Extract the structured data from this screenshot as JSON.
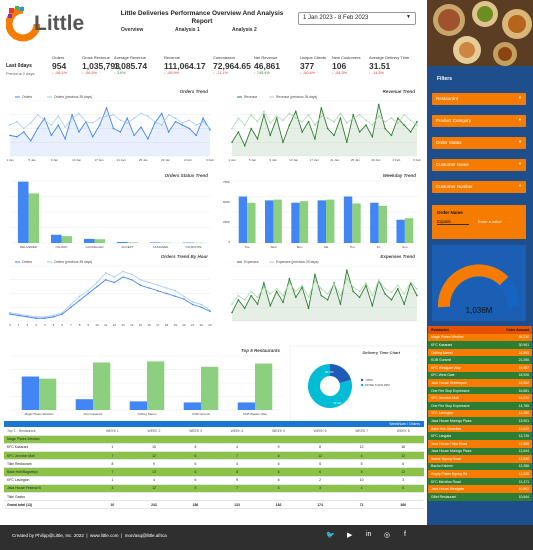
{
  "brand": {
    "name": "Little"
  },
  "title": "Little Deliveries Performance Overview And Analysis Report",
  "nav": [
    "Overview",
    "Analysis 1",
    "Analysis 2"
  ],
  "date_range": "1 Jan 2023 - 8 Feb 2023",
  "last_days": {
    "label": "Last 0days",
    "sub": "Previous 0 days"
  },
  "kpis": [
    {
      "label": "Orders",
      "value": "954",
      "delta": "↓ -56.1%",
      "dir": "down"
    },
    {
      "label": "Gross Revenue",
      "value": "1,035,793",
      "delta": "↓ -56.4%",
      "dir": "down"
    },
    {
      "label": "Average Revenue",
      "value": "1,085.74",
      "delta": "↑ 3.6%",
      "dir": "up"
    },
    {
      "label": "Revenue",
      "value": "111,064.17",
      "delta": "↓ -55.9%",
      "dir": "down"
    },
    {
      "label": "Commission",
      "value": "72,964.65",
      "delta": "↓ -71.1%",
      "dir": "down"
    },
    {
      "label": "Net Revenue",
      "value": "46,861",
      "delta": "↑ 745.4%",
      "dir": "up"
    },
    {
      "label": "Unique Clients",
      "value": "377",
      "delta": "↓ -50.4%",
      "dir": "down"
    },
    {
      "label": "New Customers",
      "value": "106",
      "delta": "↓ -54.3%",
      "dir": "down"
    },
    {
      "label": "Average Delivery Time",
      "value": "31.51",
      "delta": "↓ -14.5%",
      "dir": "down"
    }
  ],
  "charts": {
    "orders_trend": {
      "title": "Orders Trend",
      "legend": [
        "Orders",
        "Orders (previous 39 days)"
      ],
      "colors": [
        "#4285f4",
        "#9fc5f8"
      ],
      "ticks": [
        "1 Jan",
        "5 Jan",
        "9 Jan",
        "13 Jan",
        "17 Jan",
        "21 Jan",
        "25 Jan",
        "29 Jan",
        "2 Feb",
        "6 Feb"
      ]
    },
    "revenue_trend": {
      "title": "Revenue Trend",
      "legend": [
        "Revenue",
        "Revenue (previous 39 days)"
      ],
      "colors": [
        "#2e7d32",
        "#a5d6a7"
      ],
      "ticks": [
        "1 Jan",
        "5 Jan",
        "9 Jan",
        "13 Jan",
        "17 Jan",
        "21 Jan",
        "25 Jan",
        "29 Jan",
        "2 Feb",
        "6 Feb"
      ]
    },
    "status_trend": {
      "title": "Orders Status Trend",
      "categories": [
        "DELIVERED",
        "ON-WAY",
        "CANCELLED",
        "ACCEPT",
        "ASSIGNED",
        "ON-ROUTE"
      ]
    },
    "weekday_trend": {
      "title": "Weekday Trend",
      "categories": [
        "Tue",
        "Wed",
        "Mon",
        "Sat",
        "Thu",
        "Fri",
        "Sun"
      ],
      "yticks": [
        "750K",
        "500K",
        "250K",
        "0"
      ]
    },
    "hour_trend": {
      "title": "Orders Trend By Hour",
      "legend": [
        "Orders",
        "Orders (previous 39 days)"
      ],
      "ticks": [
        "0",
        "1",
        "2",
        "3",
        "4",
        "5",
        "6",
        "7",
        "8",
        "9",
        "10",
        "11",
        "12",
        "13",
        "14",
        "15",
        "16",
        "17",
        "18",
        "19",
        "20",
        "21",
        "22",
        "23"
      ]
    },
    "expenses_trend": {
      "title": "Expenses Trend",
      "legend": [
        "Expenses",
        "Expenses (previous 39 days)"
      ]
    },
    "top5": {
      "title": "Top 5 Restaurants",
      "categories": [
        "Magic Plates Westlan",
        "KFC Kasarani",
        "Golfing Damei",
        "KOB Gursmit",
        "KOB Walden Way"
      ]
    },
    "delivery_time": {
      "title": "Delivery Time Chart",
      "legend": [
        "<25M",
        "MORE THAN 25M"
      ],
      "values": [
        20.4,
        79.6
      ],
      "labels": [
        "20.4%",
        "79.6%"
      ]
    }
  },
  "chart_data": [
    {
      "type": "line",
      "title": "Orders Trend",
      "series": [
        {
          "name": "Orders",
          "values": [
            30,
            28,
            35,
            22,
            40,
            55,
            30,
            45,
            25,
            60,
            35,
            50,
            28,
            45,
            70,
            40,
            35,
            55,
            30,
            42,
            25,
            48,
            62,
            35,
            50,
            45,
            40,
            30,
            55,
            38
          ]
        },
        {
          "name": "Orders (previous 39 days)",
          "values": [
            45,
            50,
            40,
            48,
            60,
            52,
            45,
            58,
            42,
            55,
            62,
            50,
            48,
            55,
            58,
            60,
            52,
            48,
            55,
            62,
            58,
            50,
            45,
            60,
            55,
            48,
            52,
            45,
            50,
            40
          ]
        }
      ]
    },
    {
      "type": "line",
      "title": "Revenue Trend",
      "series": [
        {
          "name": "Revenue",
          "values": [
            20,
            35,
            15,
            40,
            25,
            60,
            30,
            55,
            20,
            45,
            65,
            35,
            50,
            25,
            70,
            40,
            30,
            55,
            20,
            60,
            35,
            45,
            28,
            75,
            40,
            30,
            55,
            45,
            35,
            50
          ]
        },
        {
          "name": "Revenue (previous 39 days)",
          "values": [
            40,
            55,
            45,
            60,
            50,
            65,
            48,
            58,
            52,
            62,
            55,
            50,
            60,
            45,
            58,
            55,
            50,
            62,
            48,
            55,
            60,
            52,
            45,
            58,
            50,
            55,
            48,
            60,
            52,
            45
          ]
        }
      ]
    },
    {
      "type": "bar",
      "title": "Orders Status Trend",
      "categories": [
        "DELIVERED",
        "ON-WAY",
        "CANCELLED",
        "ACCEPT",
        "ASSIGNED",
        "ON-ROUTE"
      ],
      "series": [
        {
          "name": "Orders",
          "values": [
            890,
            120,
            60,
            15,
            8,
            6
          ]
        },
        {
          "name": "Orders (previous 39 days)",
          "values": [
            720,
            100,
            55,
            10,
            5,
            4
          ]
        }
      ]
    },
    {
      "type": "bar",
      "title": "Weekday Trend",
      "categories": [
        "Tue",
        "Wed",
        "Mon",
        "Sat",
        "Thu",
        "Fri",
        "Sun"
      ],
      "series": [
        {
          "name": "Revenue",
          "values": [
            600000,
            550000,
            520000,
            550000,
            600000,
            520000,
            300000
          ]
        },
        {
          "name": "Revenue (previous)",
          "values": [
            520000,
            560000,
            540000,
            560000,
            510000,
            480000,
            320000
          ]
        }
      ]
    },
    {
      "type": "line",
      "title": "Orders Trend By Hour",
      "series": [
        {
          "name": "Orders",
          "values": [
            5,
            4,
            3,
            2,
            2,
            3,
            5,
            10,
            15,
            20,
            25,
            30,
            28,
            32,
            30,
            26,
            24,
            22,
            20,
            18,
            16,
            12,
            10,
            7
          ]
        },
        {
          "name": "Orders (previous 39 days)",
          "values": [
            6,
            5,
            4,
            3,
            3,
            4,
            6,
            12,
            18,
            22,
            28,
            35,
            32,
            36,
            34,
            30,
            28,
            26,
            24,
            22,
            18,
            14,
            12,
            8
          ]
        }
      ]
    },
    {
      "type": "line",
      "title": "Expenses Trend",
      "series": [
        {
          "name": "Expenses",
          "values": [
            10,
            25,
            15,
            30,
            20,
            45,
            18,
            35,
            22,
            50,
            28,
            40,
            15,
            55,
            30,
            25,
            45,
            20,
            60,
            35,
            28,
            42,
            18,
            48,
            32,
            25,
            38,
            20,
            45,
            30
          ]
        },
        {
          "name": "Expenses (previous 39 days)",
          "values": [
            20,
            30,
            25,
            35,
            28,
            40,
            32,
            38,
            30,
            45,
            35,
            42,
            28,
            48,
            38,
            32,
            44,
            30,
            50,
            40,
            35,
            45,
            30,
            48,
            38,
            34,
            42,
            32,
            46,
            38
          ]
        }
      ]
    },
    {
      "type": "bar",
      "title": "Top 5 Restaurants",
      "categories": [
        "Magic Plates Westlan",
        "KFC Kasarani",
        "Golfing Damei",
        "KOB Gursmit",
        "KOB Walden Way"
      ],
      "series": [
        {
          "name": "Orders",
          "values": [
            62,
            20,
            16,
            14,
            14
          ]
        },
        {
          "name": "Orders (previous)",
          "values": [
            58,
            88,
            90,
            80,
            86
          ]
        }
      ]
    },
    {
      "type": "pie",
      "title": "Delivery Time Chart",
      "categories": [
        "<25M",
        "MORE THAN 25M"
      ],
      "values": [
        20.4,
        79.6
      ]
    }
  ],
  "sidebar": {
    "filters_label": "Filters",
    "filters": [
      "Restaurant",
      "Product Category",
      "Order Status",
      "Customer Name",
      "Customer Number"
    ],
    "order_name": {
      "label": "Order Name",
      "op": "Equals",
      "placeholder": "Enter a value"
    },
    "gauge_value": "1,036M",
    "table": {
      "headers": [
        "Restaurant",
        "Order Amount"
      ],
      "rows": [
        [
          "Magic Plates Westlan",
          "36,210"
        ],
        [
          "KFC Kasarani",
          "30,961"
        ],
        [
          "Golfing Damei",
          "24,893"
        ],
        [
          "KOB Gursmit",
          "21,395"
        ],
        [
          "KFC Westgate Way",
          "19,987"
        ],
        [
          "KFC West Gate",
          "18,926"
        ],
        [
          "Java House Greenspan",
          "18,502"
        ],
        [
          "One Fire Stop Expressive",
          "16,881"
        ],
        [
          "KFC Junction Mall",
          "16,274"
        ],
        [
          "One Fire Stop Expressive",
          "14,765"
        ],
        [
          "KFC Lavington",
          "14,280"
        ],
        [
          "Java House Morings Plaza",
          "13,901"
        ],
        [
          "Bake Hub Dinnettes",
          "13,622"
        ],
        [
          "KFC Langata",
          "13,726"
        ],
        [
          "Java House Thika Road",
          "12,888"
        ],
        [
          "Java House Morings Plaza",
          "12,644"
        ],
        [
          "Barbie Ngong Road",
          "12,520"
        ],
        [
          "Bacho Kitchen",
          "12,358"
        ],
        [
          "Empty Plates Ngong Rd",
          "11,828"
        ],
        [
          "KFC Meridian Road",
          "11,471"
        ],
        [
          "Java House Westgate",
          "10,802"
        ],
        [
          "Gillet Restaurant",
          "10,644"
        ]
      ]
    }
  },
  "weekly": {
    "header": "WeekNum / Orders",
    "cols": [
      "Top T... Restaurant",
      "WEEK 1",
      "WEEK 2",
      "WEEK 3",
      "WEEK 4",
      "WEEK 5",
      "WEEK 6",
      "WEEK 7",
      "WEEK 8"
    ],
    "rows": [
      [
        "Magic Plates Westlan",
        "",
        "",
        "",
        "",
        "",
        "",
        "",
        "",
        true
      ],
      [
        "KFC Kasarani",
        "1",
        "15",
        "8",
        "4",
        "9",
        "8",
        "12",
        "16",
        false
      ],
      [
        "KFC Junction Mall",
        "7",
        "12",
        "6",
        "7",
        "6",
        "12",
        "4",
        "12",
        true
      ],
      [
        "Tikiri Restaurant",
        "8",
        "9",
        "6",
        "4",
        "6",
        "5",
        "5",
        "6",
        false
      ],
      [
        "Bake Hub/Bagwelpo",
        "7",
        "13",
        "6",
        "8",
        "6",
        "6",
        "5",
        "12",
        true
      ],
      [
        "KFC Lavington",
        "1",
        "4",
        "6",
        "9",
        "6",
        "2",
        "10",
        "3",
        false
      ],
      [
        "Java House Festival B",
        "3",
        "12",
        "9",
        "7",
        "6",
        "3",
        "4",
        "6",
        true
      ],
      [
        "Tikiri Gastro",
        "",
        "",
        "",
        "",
        "",
        "",
        "",
        "",
        false
      ]
    ],
    "total": [
      "Grand total (13)",
      "10",
      "243",
      "186",
      "133",
      "182",
      "174",
      "71",
      "366"
    ]
  },
  "footer": {
    "credit": "Created by Philipp@Little, Inc. 2022",
    "site": "www.little.com",
    "mail": "mon/asq@little.africa"
  },
  "social_icons": [
    "twitter-icon",
    "youtube-icon",
    "linkedin-icon",
    "instagram-icon",
    "facebook-icon"
  ]
}
